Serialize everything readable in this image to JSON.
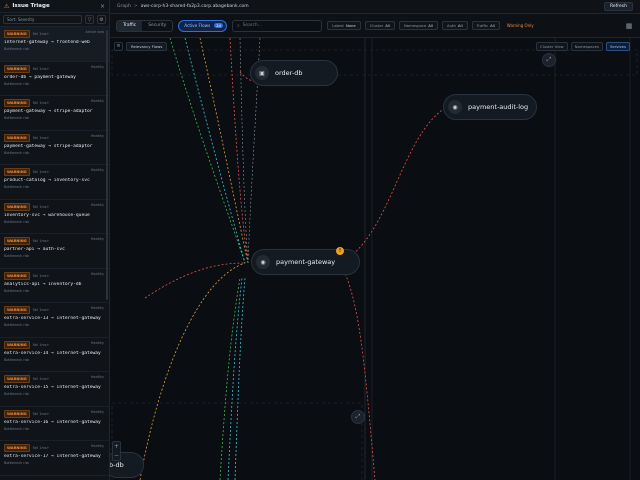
{
  "sidebar": {
    "title": "Issue Triage",
    "close_icon": "×",
    "sort_label": "Sort: Severity",
    "items": [
      {
        "badge": "WARNING",
        "fail": "Fail 1ms+",
        "age": "Active now",
        "route": "internet-gateway → frontend-web",
        "detail": "Bottleneck risk"
      },
      {
        "badge": "WARNING",
        "fail": "Fail 1ms+",
        "age": "Healthy",
        "route": "order-db → payment-gateway",
        "detail": "Bottleneck risk"
      },
      {
        "badge": "WARNING",
        "fail": "Fail 1ms+",
        "age": "Healthy",
        "route": "payment-gateway → stripe-adaptor",
        "detail": "Bottleneck risk"
      },
      {
        "badge": "WARNING",
        "fail": "Fail 1ms+",
        "age": "Healthy",
        "route": "payment-gateway → stripe-adaptor",
        "detail": "Bottleneck risk"
      },
      {
        "badge": "WARNING",
        "fail": "Fail 1ms+",
        "age": "Healthy",
        "route": "product-catalog → inventory-svc",
        "detail": "Bottleneck risk"
      },
      {
        "badge": "WARNING",
        "fail": "Fail 1ms+",
        "age": "Healthy",
        "route": "inventory-svc → warehouse-queue",
        "detail": "Bottleneck risk"
      },
      {
        "badge": "WARNING",
        "fail": "Fail 1ms+",
        "age": "Healthy",
        "route": "partner-api → auth-svc",
        "detail": "Bottleneck risk"
      },
      {
        "badge": "WARNING",
        "fail": "Fail 1ms+",
        "age": "Healthy",
        "route": "analytics-api → inventory-db",
        "detail": "Bottleneck risk"
      },
      {
        "badge": "WARNING",
        "fail": "Fail 1ms+",
        "age": "Healthy",
        "route": "extra-service-13 → internet-gateway",
        "detail": "Bottleneck risk"
      },
      {
        "badge": "WARNING",
        "fail": "Fail 1ms+",
        "age": "Healthy",
        "route": "extra-service-14 → internet-gateway",
        "detail": "Bottleneck risk"
      },
      {
        "badge": "WARNING",
        "fail": "Fail 1ms+",
        "age": "Healthy",
        "route": "extra-service-15 → internet-gateway",
        "detail": "Bottleneck risk"
      },
      {
        "badge": "WARNING",
        "fail": "Fail 1ms+",
        "age": "Healthy",
        "route": "extra-service-16 → internet-gateway",
        "detail": "Bottleneck risk"
      },
      {
        "badge": "WARNING",
        "fail": "Fail 1ms+",
        "age": "Healthy",
        "route": "extra-service-17 → internet-gateway",
        "detail": "Bottleneck risk"
      }
    ]
  },
  "topbar": {
    "crumb_root": "Graph",
    "crumb_sep": ">",
    "crumb_current": "aws-corp-h3-shared-fa2p3.corp.abagebank.com",
    "refresh_label": "Refresh"
  },
  "toolbar": {
    "tabs": [
      "Traffic",
      "Security"
    ],
    "active_tab": "Traffic",
    "pill_label": "Active Flows",
    "pill_count": "24",
    "search_placeholder": "Search...",
    "filters": [
      {
        "label": "Latest",
        "value": "None"
      },
      {
        "label": "Cluster",
        "value": "All"
      },
      {
        "label": "Namespace",
        "value": "All"
      },
      {
        "label": "Auth",
        "value": "All"
      },
      {
        "label": "Traffic",
        "value": "All"
      }
    ],
    "warning_label": "Warning Only"
  },
  "canvas": {
    "subbar_label": "Relevancy Flows",
    "views": [
      "Cluster View",
      "Namespaces",
      "Services"
    ],
    "active_view": "Services",
    "nodes": {
      "order_db": "order-db",
      "payment_audit": "payment-audit-log",
      "payment_gateway": "payment-gateway",
      "bottom_db": "b-db"
    },
    "alert_count": "!"
  },
  "colors": {
    "warning": "#f0883e",
    "edge_red": "#e5534b",
    "edge_green": "#3fb950",
    "edge_teal": "#39c5cf",
    "edge_orange": "#e3a03b",
    "accent": "#2f6fe0"
  }
}
